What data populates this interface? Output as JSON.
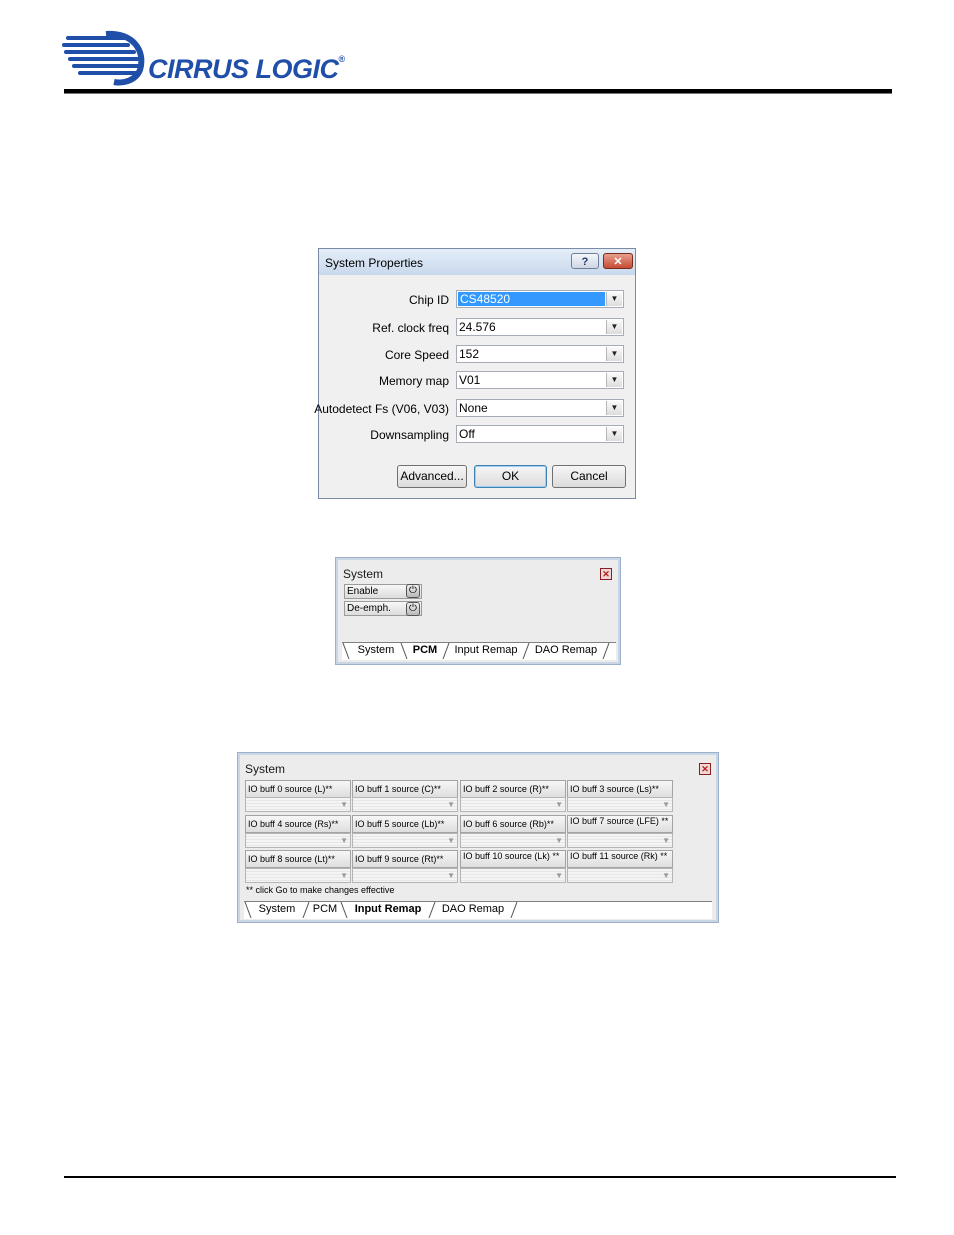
{
  "brand": {
    "name": "CIRRUS LOGIC",
    "reg": "®",
    "color": "#1f4fa8"
  },
  "dialog": {
    "title": "System Properties",
    "help_icon": "?",
    "close_icon": "✕",
    "fields": [
      {
        "label": "Chip ID",
        "value": "CS48520",
        "selected": true
      },
      {
        "label": "Ref. clock freq",
        "value": "24.576"
      },
      {
        "label": "Core Speed",
        "value": "152"
      },
      {
        "label": "Memory map",
        "value": "V01"
      },
      {
        "label": "Autodetect Fs (V06, V03)",
        "value": "None"
      },
      {
        "label": "Downsampling",
        "value": "Off"
      }
    ],
    "buttons": {
      "advanced": "Advanced...",
      "ok": "OK",
      "cancel": "Cancel"
    }
  },
  "pcm_panel": {
    "title": "System",
    "controls": [
      {
        "label": "Enable",
        "icon": "power-icon"
      },
      {
        "label": "De-emph.",
        "icon": "power-icon"
      }
    ],
    "tabs": [
      "System",
      "PCM",
      "Input Remap",
      "DAO Remap"
    ],
    "active_tab": "PCM"
  },
  "remap_panel": {
    "title": "System",
    "cells": [
      "IO buff 0 source (L)**",
      "IO buff 1 source (C)**",
      "IO buff 2 source (R)**",
      "IO buff 3 source (Ls)**",
      "IO buff 4 source (Rs)**",
      "IO buff 5 source (Lb)**",
      "IO buff 6 source (Rb)**",
      "IO buff 7 source (LFE) **",
      "IO buff 8 source (Lt)**",
      "IO buff 9 source (Rt)**",
      "IO buff 10 source (Lk) **",
      "IO buff 11 source (Rk) **"
    ],
    "note": "** click Go to make changes effective",
    "tabs": [
      "System",
      "PCM",
      "Input Remap",
      "DAO Remap"
    ],
    "active_tab": "Input Remap"
  }
}
